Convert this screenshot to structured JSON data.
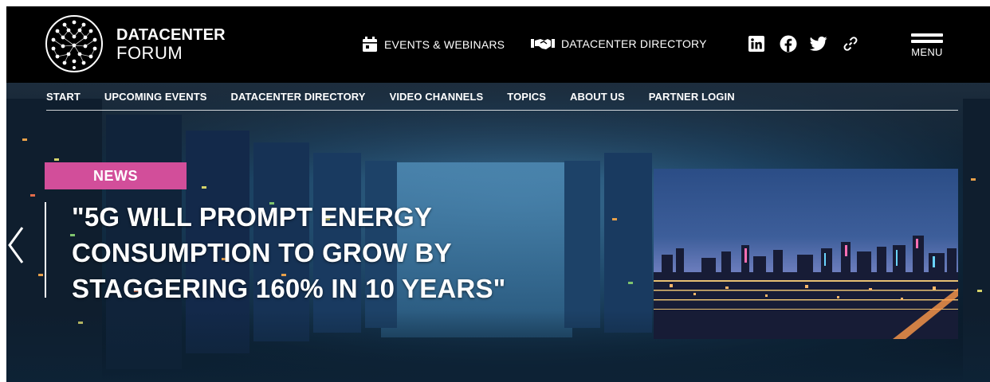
{
  "site": {
    "logo_line1": "DATACENTER",
    "logo_line2": "FORUM"
  },
  "topbar": {
    "events_label": "EVENTS & WEBINARS",
    "directory_label": "DATACENTER DIRECTORY",
    "menu_label": "MENU",
    "social": [
      "linkedin-icon",
      "facebook-icon",
      "twitter-icon",
      "link-icon"
    ]
  },
  "subnav": {
    "items": [
      "START",
      "UPCOMING EVENTS",
      "DATACENTER DIRECTORY",
      "VIDEO CHANNELS",
      "TOPICS",
      "ABOUT US",
      "PARTNER LOGIN"
    ]
  },
  "hero": {
    "badge": "NEWS",
    "headline": "\"5G WILL PROMPT ENERGY CONSUMPTION TO GROW BY STAGGERING 160% IN 10 YEARS\"",
    "accent_color": "#d24e9a"
  }
}
